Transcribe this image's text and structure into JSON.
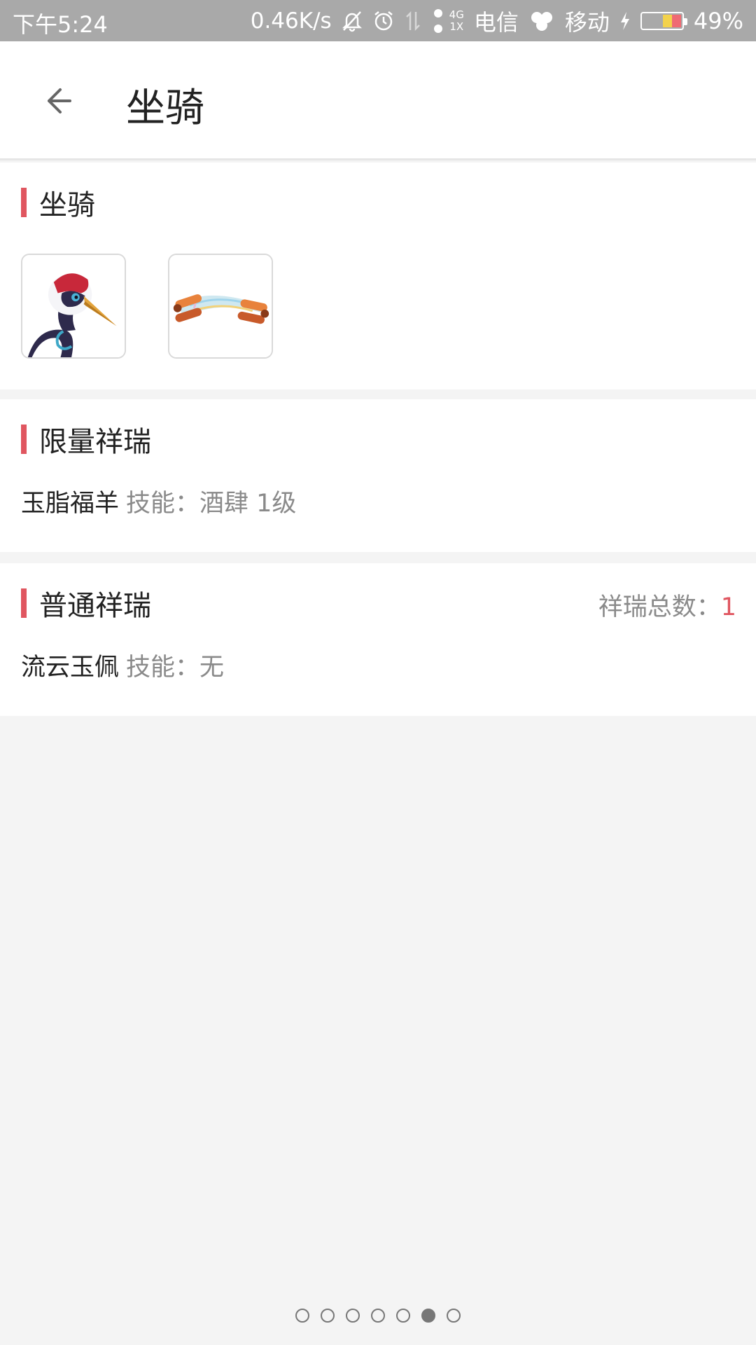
{
  "status_bar": {
    "time": "下午5:24",
    "net_speed": "0.46K/s",
    "net_type_top": "4G",
    "net_type_bottom": "1X",
    "carrier1": "电信",
    "carrier2": "移动",
    "battery": "49%",
    "icons": [
      "bell-off-icon",
      "alarm-icon",
      "data-arrows-icon",
      "signal-icon",
      "charging-icon",
      "battery-icon"
    ]
  },
  "header": {
    "title": "坐骑",
    "back_icon": "arrow-left-icon"
  },
  "mount_section": {
    "title": "坐骑",
    "items": [
      {
        "name": "crane-mount-icon"
      },
      {
        "name": "scroll-mount-icon"
      }
    ]
  },
  "limited_section": {
    "title": "限量祥瑞",
    "item_name": "玉脂福羊",
    "item_skill": "技能：酒肆 1级"
  },
  "normal_section": {
    "title": "普通祥瑞",
    "total_label": "祥瑞总数：",
    "total_value": "1",
    "item_name": "流云玉佩",
    "item_skill": "技能：无"
  },
  "pager": {
    "count": 7,
    "active_index": 5
  },
  "colors": {
    "accent": "#e05660",
    "status_bar_bg": "#a9a9a9",
    "page_bg": "#f4f4f4"
  }
}
